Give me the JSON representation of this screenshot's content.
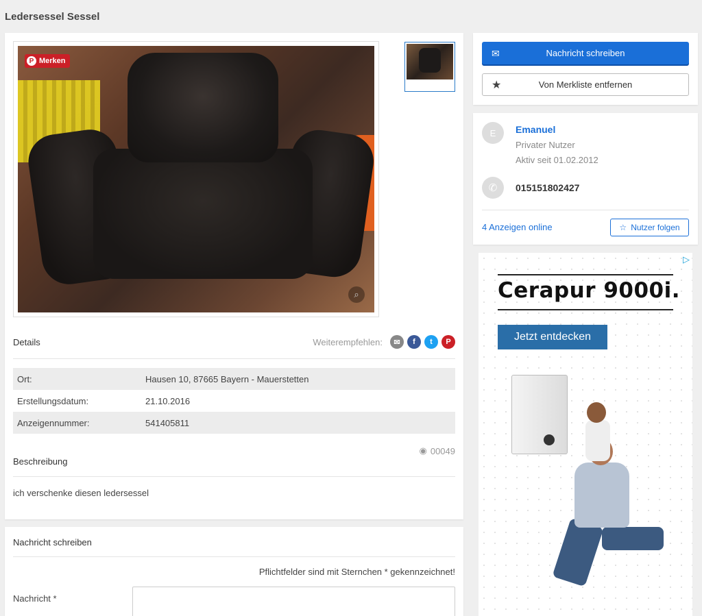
{
  "page": {
    "title": "Ledersessel Sessel"
  },
  "gallery": {
    "pin_label": "Merken"
  },
  "details": {
    "heading": "Details",
    "share_label": "Weiterempfehlen:",
    "rows": [
      {
        "key": "Ort:",
        "value": "Hausen 10, 87665 Bayern - Mauerstetten"
      },
      {
        "key": "Erstellungsdatum:",
        "value": "21.10.2016"
      },
      {
        "key": "Anzeigennummer:",
        "value": "541405811"
      }
    ],
    "views": "00049"
  },
  "description": {
    "heading": "Beschreibung",
    "text": "ich verschenke diesen ledersessel"
  },
  "message_form": {
    "heading": "Nachricht schreiben",
    "required_note": "Pflichtfelder sind mit Sternchen * gekennzeichnet!",
    "message_label": "Nachricht *",
    "message_value": ""
  },
  "actions": {
    "write_message": "Nachricht schreiben",
    "remove_watchlist": "Von Merkliste entfernen"
  },
  "seller": {
    "avatar_letter": "E",
    "name": "Emanuel",
    "type": "Privater Nutzer",
    "active_since": "Aktiv seit 01.02.2012",
    "phone": "015151802427",
    "ads_online": "4 Anzeigen online",
    "follow_label": "Nutzer folgen"
  },
  "ad": {
    "title": "Cerapur 9000i.",
    "cta": "Jetzt entdecken"
  },
  "colors": {
    "primary": "#1a6fd8",
    "pinterest": "#cb2027",
    "email": "#888888",
    "facebook": "#3b5998",
    "twitter": "#1da1f2"
  }
}
